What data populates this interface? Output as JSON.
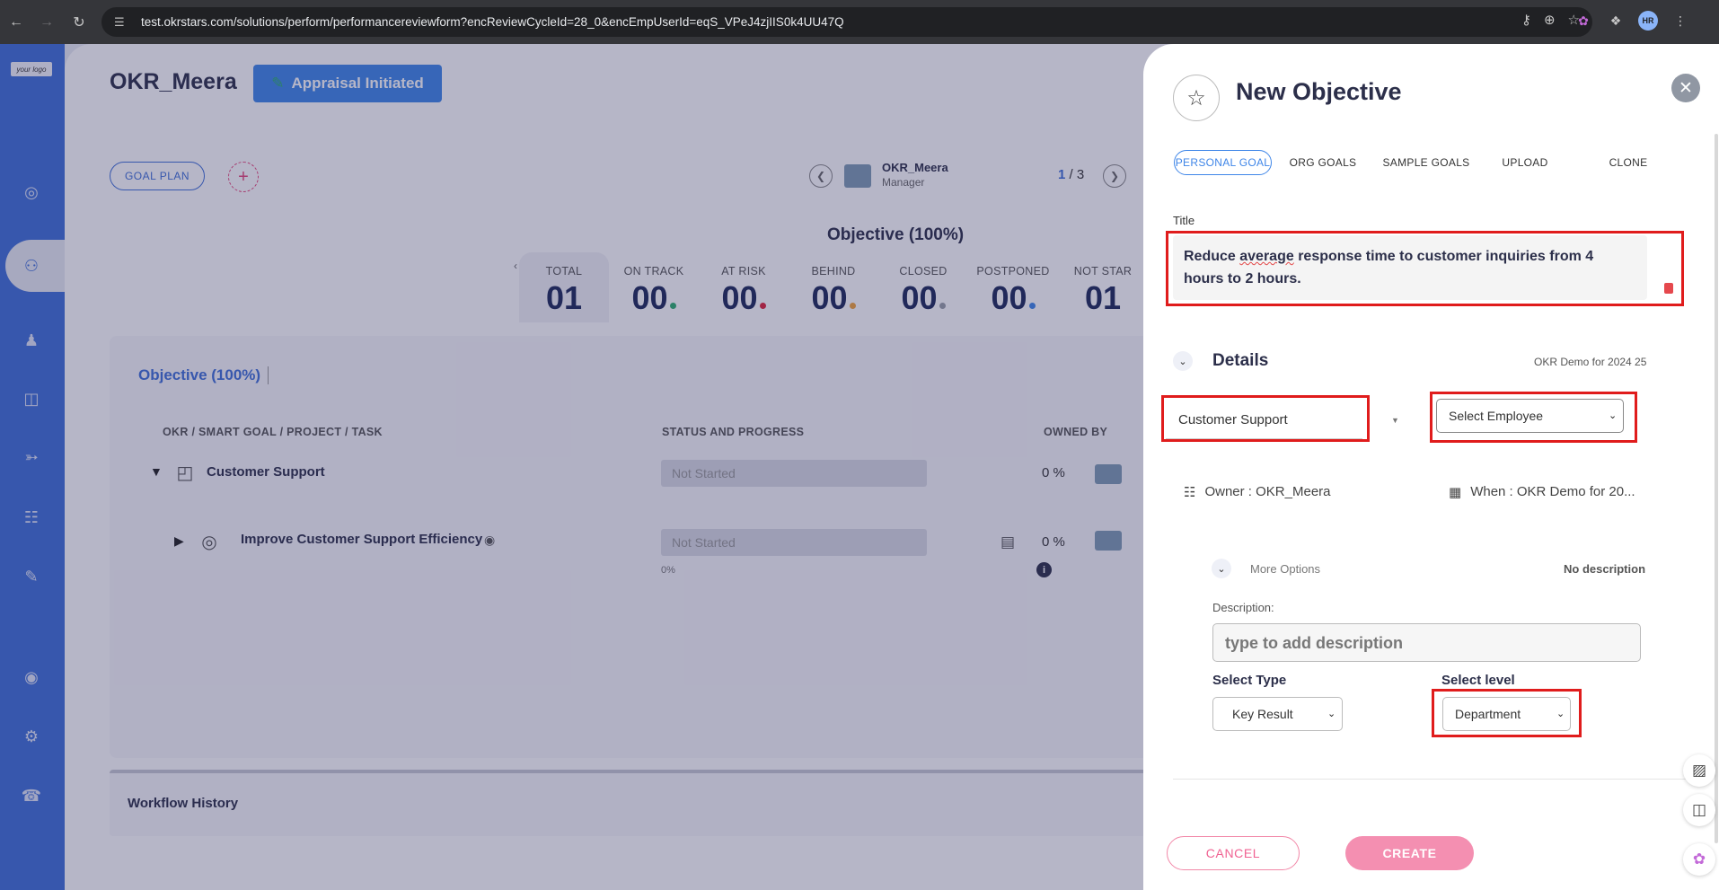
{
  "browser": {
    "url": "test.okrstars.com/solutions/perform/performancereviewform?encReviewCycleId=28_0&encEmpUserId=eqS_VPeJ4zjIIS0k4UU47Q",
    "profile_initials": "HR"
  },
  "sidebar": {
    "logo_text": "your logo",
    "items": [
      {
        "icon": "target-icon"
      },
      {
        "icon": "team-icon"
      },
      {
        "icon": "person-icon"
      },
      {
        "icon": "book-icon"
      },
      {
        "icon": "handshake-icon"
      },
      {
        "icon": "org-chart-icon"
      },
      {
        "icon": "review-icon"
      },
      {
        "icon": "eye-icon"
      },
      {
        "icon": "gear-icon"
      },
      {
        "icon": "support-agent-icon"
      }
    ]
  },
  "header": {
    "employee_name": "OKR_Meera",
    "status_button": "Appraisal Initiated",
    "goal_plan_button": "GOAL PLAN"
  },
  "pager": {
    "name": "OKR_Meera",
    "role": "Manager",
    "current": "1",
    "separator": " / ",
    "total": "3"
  },
  "objective_heading": "Objective (100%)",
  "stats": [
    {
      "label": "TOTAL",
      "value": "01",
      "dot_color": ""
    },
    {
      "label": "ON TRACK",
      "value": "00",
      "dot_color": "#2eaf6f"
    },
    {
      "label": "AT RISK",
      "value": "00",
      "dot_color": "#e0243a"
    },
    {
      "label": "BEHIND",
      "value": "00",
      "dot_color": "#f2a33a"
    },
    {
      "label": "CLOSED",
      "value": "00",
      "dot_color": "#9aa0a8"
    },
    {
      "label": "POSTPONED",
      "value": "00",
      "dot_color": "#3f86e8"
    },
    {
      "label": "NOT STAR",
      "value": "01",
      "dot_color": ""
    }
  ],
  "panel": {
    "tab_label": "Objective (100%)",
    "columns": {
      "okr": "OKR / SMART GOAL / PROJECT / TASK",
      "status": "STATUS AND PROGRESS",
      "owned": "OWNED BY"
    },
    "rows": [
      {
        "title": "Customer Support",
        "status": "Not Started",
        "percent": "0",
        "percent_sign": "%"
      },
      {
        "title": "Improve Customer Support Efficiency",
        "status": "Not Started",
        "percent": "0",
        "percent_sign": "%",
        "progress_label": "0%"
      }
    ]
  },
  "workflow_history": "Workflow History",
  "drawer": {
    "title": "New Objective",
    "tabs": [
      "PERSONAL GOAL",
      "ORG GOALS",
      "SAMPLE GOALS",
      "UPLOAD",
      "CLONE"
    ],
    "active_tab": "PERSONAL GOAL",
    "title_label": "Title",
    "title_value_parts": [
      "Reduce ",
      "average",
      " response time to customer inquiries from 4 hours to 2 hours."
    ],
    "details_label": "Details",
    "details_meta": "OKR Demo for 2024 25",
    "department_value": "Customer Support",
    "employee_placeholder": "Select Employee",
    "owner_text": "Owner : OKR_Meera",
    "when_text": "When : OKR Demo for 20...",
    "more_options_label": "More Options",
    "no_description": "No description",
    "description_label": "Description:",
    "description_placeholder": "type to add description",
    "select_type_label": "Select Type",
    "select_type_value": "Key Result",
    "select_level_label": "Select level",
    "select_level_value": "Department",
    "cancel_label": "CANCEL",
    "create_label": "CREATE"
  },
  "colors": {
    "sidebar": "#3f6fd8",
    "accent_blue": "#3f86e8",
    "highlight_red": "#e01c1c",
    "create_pink": "#f48fb1"
  }
}
